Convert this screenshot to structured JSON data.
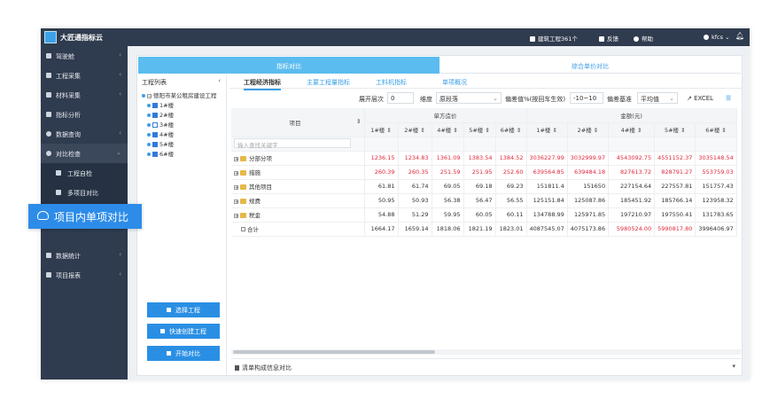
{
  "app": {
    "title": "大匠通指标云"
  },
  "topbar": {
    "project_count": "建筑工程361个",
    "feedback": "反馈",
    "help": "帮助",
    "user": "kfcs",
    "user_caret": "⌄"
  },
  "sidebar": {
    "items": [
      {
        "label": "驾驶舱",
        "icon": "dashboard-icon"
      },
      {
        "label": "工程采集",
        "icon": "grid-icon"
      },
      {
        "label": "材料采集",
        "icon": "cubes-icon"
      },
      {
        "label": "指标分析",
        "icon": "chart-icon"
      },
      {
        "label": "数据查询",
        "icon": "search-icon"
      },
      {
        "label": "对比检查",
        "icon": "compare-icon"
      },
      {
        "label": "工程自检",
        "icon": "check-icon"
      },
      {
        "label": "多项目对比",
        "icon": "multi-icon"
      },
      {
        "label": "项目内单项对比",
        "icon": "cloud-icon"
      },
      {
        "label": "数据统计",
        "icon": "stats-icon"
      },
      {
        "label": "项目报表",
        "icon": "report-icon"
      }
    ],
    "chevron": "‹",
    "chevron_open": "⌄"
  },
  "tabs": {
    "index_compare": "指标对比",
    "unit_price_compare": "综合单价对比"
  },
  "project_list": {
    "title": "工程列表",
    "collapse": "‹",
    "root": "德阳市某公租房建设工程",
    "buildings": [
      {
        "label": "1#楼",
        "checked": true
      },
      {
        "label": "2#楼",
        "checked": true
      },
      {
        "label": "3#楼",
        "checked": false
      },
      {
        "label": "4#楼",
        "checked": true
      },
      {
        "label": "5#楼",
        "checked": true
      },
      {
        "label": "6#楼",
        "checked": true
      }
    ],
    "buttons": {
      "select": "选择工程",
      "quick_create": "快速创建工程",
      "start": "开始对比"
    }
  },
  "sub_tabs": [
    "工程经济指标",
    "主要工程量指标",
    "工料机指标",
    "单项概况"
  ],
  "filters": {
    "expand_level_label": "展开层次",
    "expand_level": "0",
    "dimension_label": "维度",
    "dimension": "原段落",
    "deviation_label": "偏差值%(按回车生效)",
    "deviation": "-10~10",
    "deviation_base_label": "偏差基准",
    "deviation_base": "平均值",
    "excel": "EXCEL"
  },
  "table": {
    "col_item": "项目",
    "group_unit": "单方造价",
    "group_amount": "金额(元)",
    "buildings": [
      "1#楼",
      "2#楼",
      "4#楼",
      "5#楼",
      "6#楼"
    ],
    "search_placeholder": "输入查找关键字",
    "rows": [
      {
        "name": "分部分项",
        "unit": [
          "1236.15",
          "1234.83",
          "1361.09",
          "1383.54",
          "1384.52"
        ],
        "amount": [
          "3036227.99",
          "3032999.97",
          "4543092.75",
          "4551152.37",
          "3035148.54"
        ],
        "red_unit": [
          0,
          1,
          2,
          3,
          4
        ],
        "red_amount": [
          0,
          1,
          2,
          3,
          4
        ],
        "folder": true
      },
      {
        "name": "措施",
        "unit": [
          "260.39",
          "260.35",
          "251.59",
          "251.95",
          "252.60"
        ],
        "amount": [
          "639564.85",
          "639484.18",
          "827613.72",
          "828791.27",
          "553759.03"
        ],
        "red_unit": [
          0,
          1,
          2,
          3,
          4
        ],
        "red_amount": [
          0,
          1,
          2,
          3,
          4
        ],
        "folder": true
      },
      {
        "name": "其他项目",
        "unit": [
          "61.81",
          "61.74",
          "69.05",
          "69.18",
          "69.23"
        ],
        "amount": [
          "151811.4",
          "151650",
          "227154.64",
          "227557.81",
          "151757.43"
        ],
        "red_unit": [],
        "red_amount": [],
        "folder": true
      },
      {
        "name": "规费",
        "unit": [
          "50.95",
          "50.93",
          "56.38",
          "56.47",
          "56.55"
        ],
        "amount": [
          "125151.84",
          "125087.86",
          "185451.92",
          "185766.14",
          "123958.32"
        ],
        "red_unit": [],
        "red_amount": [],
        "folder": true
      },
      {
        "name": "税金",
        "unit": [
          "54.88",
          "51.29",
          "59.95",
          "60.05",
          "60.11"
        ],
        "amount": [
          "134788.99",
          "125971.85",
          "197210.97",
          "197550.41",
          "131783.65"
        ],
        "red_unit": [],
        "red_amount": [],
        "folder": true
      },
      {
        "name": "合计",
        "unit": [
          "1664.17",
          "1659.14",
          "1818.06",
          "1821.19",
          "1823.01"
        ],
        "amount": [
          "4087545.07",
          "4075173.86",
          "5980524.00",
          "5990817.80",
          "3996406.97"
        ],
        "red_unit": [],
        "red_amount": [
          2,
          3
        ],
        "folder": false
      }
    ]
  },
  "bottom_bar": {
    "label": "清单构成信息对比",
    "caret": "▾"
  },
  "colors": {
    "topbar": "#2f3b4e",
    "accent": "#2a8fe4",
    "tab_active": "#5bbcef",
    "red": "#e02a3c"
  }
}
